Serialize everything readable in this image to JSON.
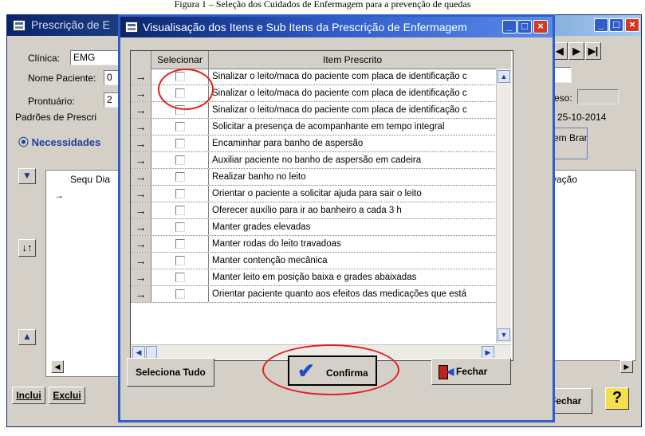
{
  "caption": "Figura 1 – Seleção dos Cuidados de Enfermagem para a prevenção de quedas",
  "background_window": {
    "title": "Prescrição de E",
    "labels": {
      "clinica": "Clínica:",
      "nome_paciente": "Nome Paciente:",
      "prontuario": "Prontuário:",
      "padroes": "Padrões de Prescri",
      "necessidades": "Necessidades",
      "peso": "eso:",
      "date": "25-10-2014",
      "em_branco": "em Branco",
      "col_seq": "Sequ",
      "col_dia": "Dia",
      "col_obs": "vação"
    },
    "values": {
      "clinica": "EMG",
      "nome_paciente": "0",
      "prontuario": "2"
    },
    "buttons": {
      "inclui": "Inclui",
      "exclui": "Exclui",
      "fechar": "Fechar",
      "help": "?"
    }
  },
  "dialog": {
    "title": "Visualisação dos Itens e Sub Itens da Prescrição de Enfermagem",
    "columns": {
      "select": "Selecionar",
      "item": "Item Prescrito"
    },
    "rows": [
      "Sinalizar o leito/maca do paciente com placa de identificação c",
      "Sinalizar o leito/maca do paciente com placa de identificação c",
      "Sinalizar o leito/maca do paciente com placa de identificação c",
      "Solicitar a presença de acompanhante em tempo integral",
      "Encaminhar para banho de aspersão",
      "Auxiliar paciente no banho de aspersão em cadeira",
      "Realizar banho no leito",
      "Orientar o paciente a solicitar ajuda para sair o leito",
      "Oferecer auxílio para ir ao banheiro a cada 3 h",
      "Manter grades elevadas",
      "Manter rodas do leito travadoas",
      "Manter contenção mecânica",
      "Manter leito em posição baixa e grades abaixadas",
      "Orientar paciente quanto aos efeitos das medicações que está"
    ],
    "buttons": {
      "select_all": "Seleciona Tudo",
      "confirm": "Confirma",
      "close": "Fechar"
    }
  },
  "colors": {
    "annotation": "#e02020",
    "dialog_border": "#2f5dc9",
    "face": "#d4d0c8"
  }
}
